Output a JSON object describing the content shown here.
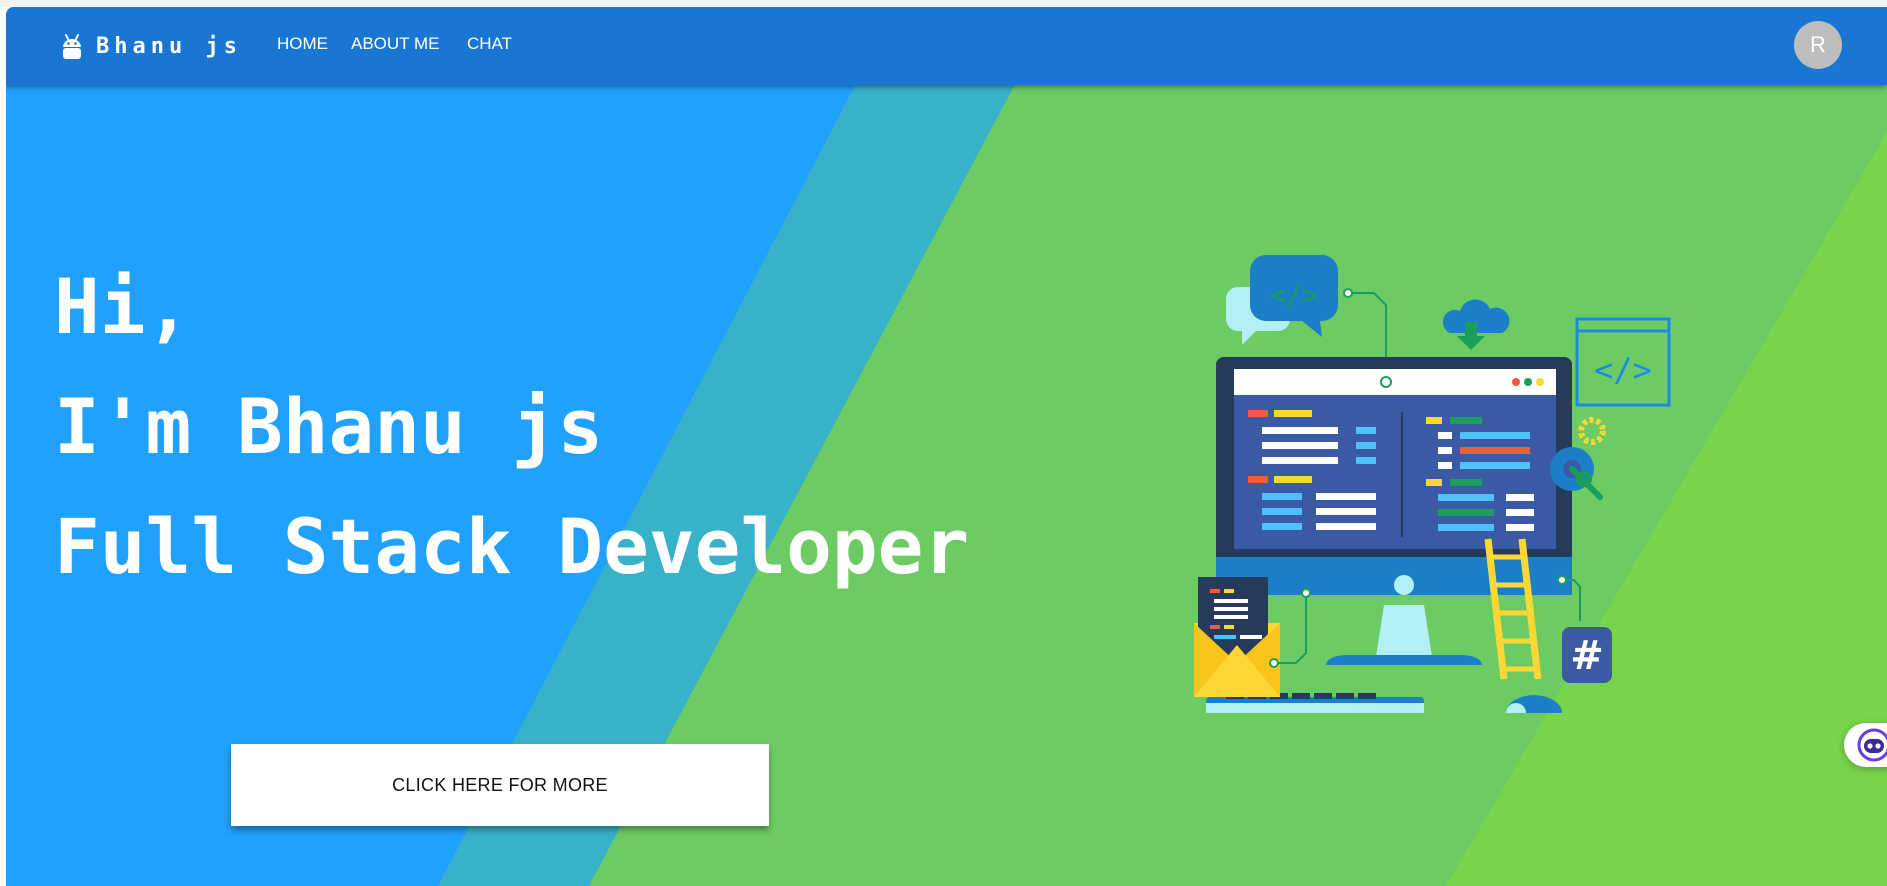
{
  "navbar": {
    "brand_icon": "android-icon",
    "brand": "Bhanu js",
    "links": [
      "HOME",
      "ABOUT ME",
      "CHAT"
    ],
    "avatar_initial": "R"
  },
  "hero": {
    "line1": "Hi,",
    "line2": "I'm Bhanu js",
    "line3": "Full Stack Developer",
    "cta": "CLICK HERE FOR MORE"
  },
  "illustration": {
    "icon": "developer-workstation-illustration",
    "code_glyph": "</>",
    "hash_glyph": "#"
  },
  "chat_widget": {
    "icon": "chatbot-icon"
  },
  "colors": {
    "navbar": "#1976d2",
    "hero_blue": "#1fa1fd",
    "hero_teal": "#38b2c9",
    "hero_green": "#6ccb63",
    "hero_lime": "#78d44b"
  }
}
